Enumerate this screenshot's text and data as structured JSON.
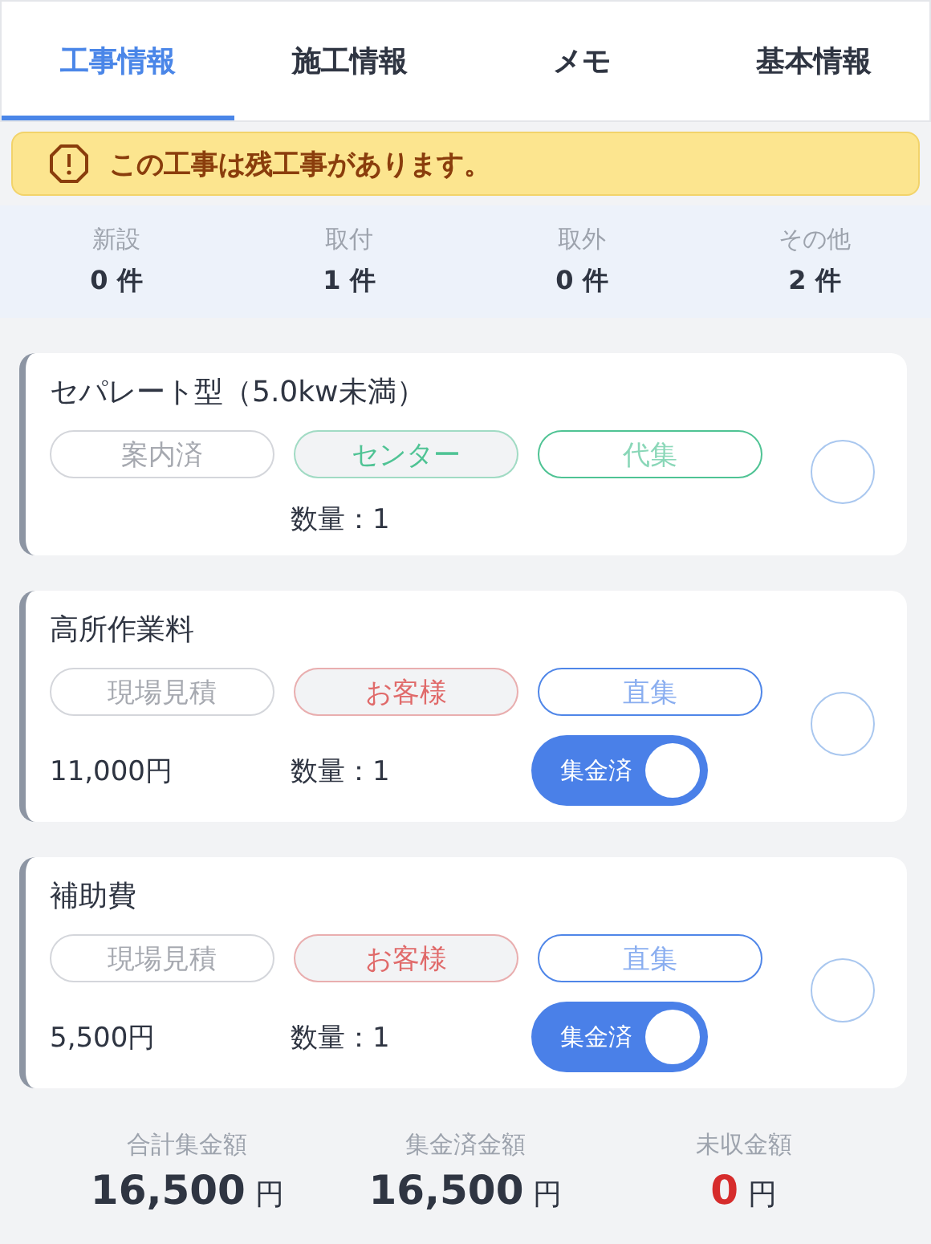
{
  "tabs": [
    {
      "label": "工事情報",
      "selected": true
    },
    {
      "label": "施工情報",
      "selected": false
    },
    {
      "label": "メモ",
      "selected": false
    },
    {
      "label": "基本情報",
      "selected": false
    }
  ],
  "alert": {
    "text": "この工事は残工事があります。"
  },
  "counts": [
    {
      "label": "新設",
      "value": "0 件"
    },
    {
      "label": "取付",
      "value": "1 件"
    },
    {
      "label": "取外",
      "value": "0 件"
    },
    {
      "label": "その他",
      "value": "2 件"
    }
  ],
  "items": [
    {
      "title": "セパレート型（5.0kw未満）",
      "tags": [
        {
          "kind": "plain",
          "label": "案内済",
          "color": "#a6a9b0"
        },
        {
          "kind": "filled",
          "label": "センター",
          "color": "#4fc394"
        },
        {
          "kind": "outline",
          "label": "代集",
          "color": "#4fc394"
        }
      ],
      "quantity": "数量：1",
      "checked": false
    },
    {
      "title": "高所作業料",
      "tags": [
        {
          "kind": "plain",
          "label": "現場見積",
          "color": "#a6a9b0"
        },
        {
          "kind": "filled",
          "label": "お客様",
          "color": "#e06a6a"
        },
        {
          "kind": "outline",
          "label": "直集",
          "color": "#4f86e8"
        }
      ],
      "price": "11,000円",
      "quantity": "数量：1",
      "toggle": {
        "label": "集金済",
        "on": true
      },
      "checked": false
    },
    {
      "title": "補助費",
      "tags": [
        {
          "kind": "plain",
          "label": "現場見積",
          "color": "#a6a9b0"
        },
        {
          "kind": "filled",
          "label": "お客様",
          "color": "#e06a6a"
        },
        {
          "kind": "outline",
          "label": "直集",
          "color": "#4f86e8"
        }
      ],
      "price": "5,500円",
      "quantity": "数量：1",
      "toggle": {
        "label": "集金済",
        "on": true
      },
      "checked": false
    }
  ],
  "totals": [
    {
      "label": "合計集金額",
      "amount": "16,500",
      "unit": "円",
      "kind": "normal"
    },
    {
      "label": "集金済金額",
      "amount": "16,500",
      "unit": "円",
      "kind": "normal"
    },
    {
      "label": "未収金額",
      "amount": "0",
      "unit": "円",
      "kind": "alert"
    }
  ]
}
